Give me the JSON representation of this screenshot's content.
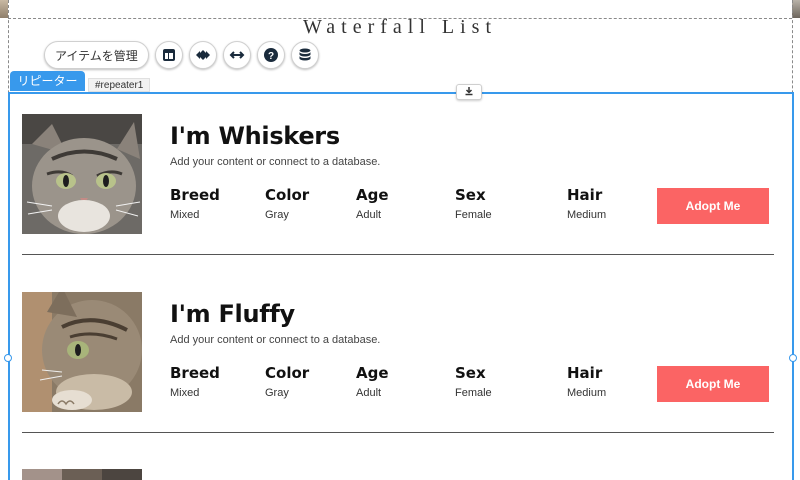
{
  "page": {
    "title": "Waterfall List"
  },
  "toolbar": {
    "manage_items_label": "アイテムを管理",
    "icons": [
      "layout-icon",
      "design-icon",
      "stretch-icon",
      "help-icon",
      "database-icon"
    ]
  },
  "repeater": {
    "label": "リピーター",
    "id": "#repeater1",
    "items": [
      {
        "name": "I'm Whiskers",
        "description": "Add your content or connect to a database.",
        "attributes": [
          {
            "key": "Breed",
            "value": "Mixed"
          },
          {
            "key": "Color",
            "value": "Gray"
          },
          {
            "key": "Age",
            "value": "Adult"
          },
          {
            "key": "Sex",
            "value": "Female"
          },
          {
            "key": "Hair",
            "value": "Medium"
          }
        ],
        "button": "Adopt Me"
      },
      {
        "name": "I'm Fluffy",
        "description": "Add your content or connect to a database.",
        "attributes": [
          {
            "key": "Breed",
            "value": "Mixed"
          },
          {
            "key": "Color",
            "value": "Gray"
          },
          {
            "key": "Age",
            "value": "Adult"
          },
          {
            "key": "Sex",
            "value": "Female"
          },
          {
            "key": "Hair",
            "value": "Medium"
          }
        ],
        "button": "Adopt Me"
      }
    ]
  },
  "colors": {
    "accent": "#3899ec",
    "button": "#fb6464"
  }
}
